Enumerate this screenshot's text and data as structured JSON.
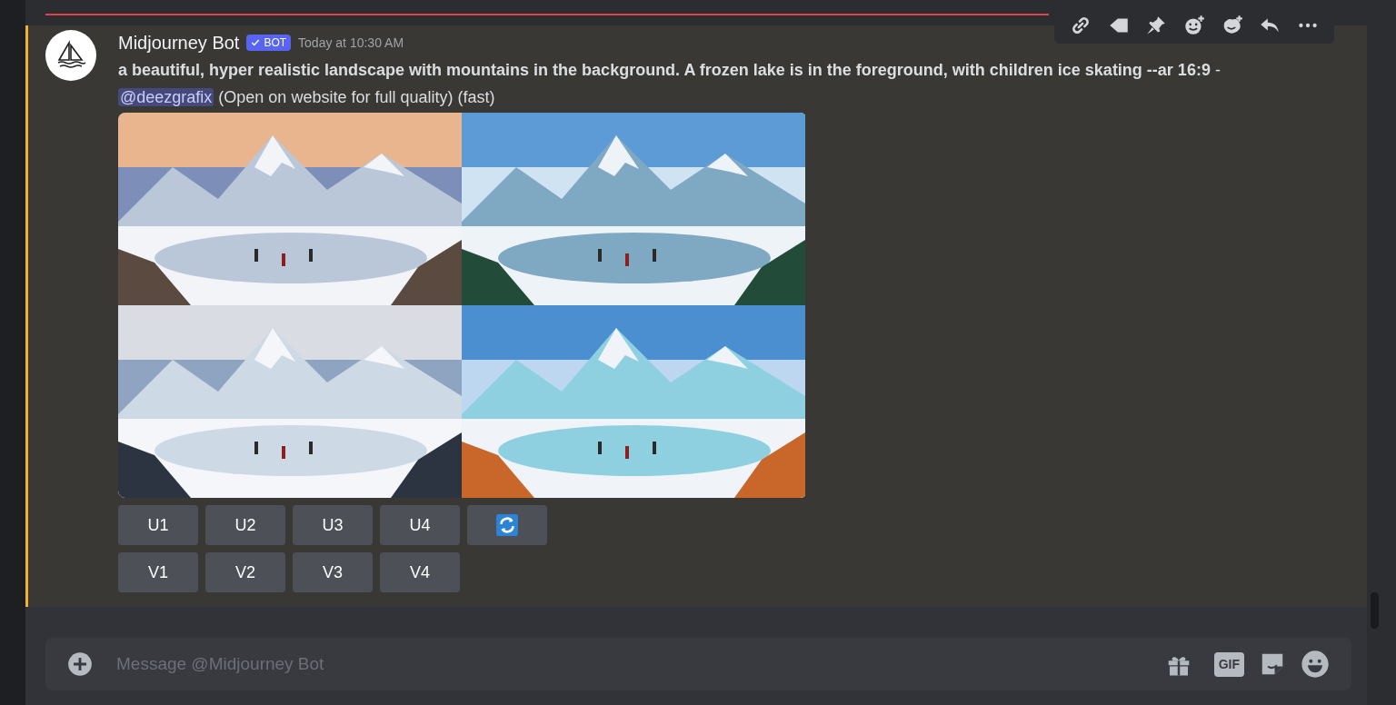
{
  "message": {
    "author": "Midjourney Bot",
    "badge": "BOT",
    "timestamp": "Today at 10:30 AM",
    "highlighted": true,
    "content": [
      {
        "kind": "bold",
        "text": "a beautiful, hyper realistic landscape with mountains in the background. A frozen lake is in the foreground, with children ice skating --ar 16:9"
      },
      {
        "kind": "plain",
        "text": " - "
      },
      {
        "kind": "mention",
        "text": "@deezgrafix"
      },
      {
        "kind": "plain",
        "text": " (Open on website for full quality) (fast)"
      }
    ],
    "images": [
      {
        "kind": "picture"
      },
      {
        "kind": "picture"
      },
      {
        "kind": "picture"
      },
      {
        "kind": "picture"
      }
    ],
    "button_rows": [
      [
        {
          "kind": "text",
          "label": "U1"
        },
        {
          "kind": "text",
          "label": "U2"
        },
        {
          "kind": "text",
          "label": "U3"
        },
        {
          "kind": "text",
          "label": "U4"
        },
        {
          "kind": "reroll"
        }
      ],
      [
        {
          "kind": "text",
          "label": "V1"
        },
        {
          "kind": "text",
          "label": "V2"
        },
        {
          "kind": "text",
          "label": "V3"
        },
        {
          "kind": "text",
          "label": "V4"
        }
      ]
    ]
  },
  "toolbar": [
    {
      "kind": "link"
    },
    {
      "kind": "tag"
    },
    {
      "kind": "pin"
    },
    {
      "kind": "reaction"
    },
    {
      "kind": "super"
    },
    {
      "kind": "reply"
    },
    {
      "kind": "more"
    }
  ],
  "composer": {
    "placeholder": "Message @Midjourney Bot",
    "gif_label": "GIF"
  }
}
